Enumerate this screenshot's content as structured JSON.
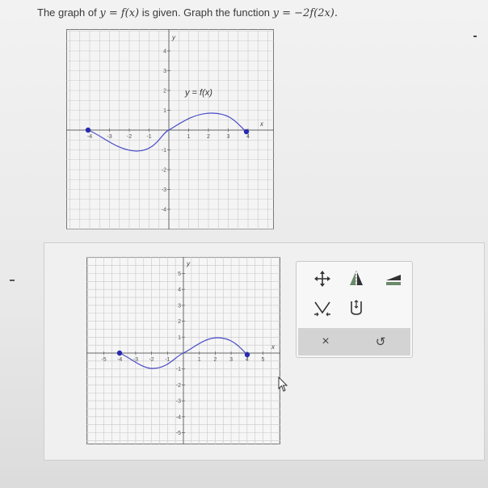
{
  "question": {
    "prefix": "The graph of",
    "given_eq": "y = f(x)",
    "middle": "is given. Graph the function",
    "target_eq": "y = −2f(2x)."
  },
  "given_graph": {
    "curve_label": "y = f(x)",
    "x_axis_label": "x",
    "y_axis_label": "y",
    "x_ticks": [
      "-4",
      "-3",
      "-2",
      "-1",
      "1",
      "2",
      "3",
      "4"
    ],
    "y_ticks": [
      "4",
      "3",
      "2",
      "1",
      "-1",
      "-2",
      "-3",
      "-4"
    ]
  },
  "answer_graph": {
    "x_axis_label": "x",
    "y_axis_label": "y",
    "x_ticks": [
      "-5",
      "-4",
      "-3",
      "-2",
      "-1",
      "1",
      "2",
      "3",
      "4",
      "5"
    ],
    "y_ticks": [
      "5",
      "4",
      "3",
      "2",
      "1",
      "-1",
      "-2",
      "-3",
      "-4",
      "-5"
    ]
  },
  "toolbar": {
    "tools": [
      "move-tool",
      "reflect-tool",
      "shrink-stretch-tool",
      "compress-tool",
      "expand-tool"
    ],
    "delete_label": "×",
    "undo_label": "↺"
  },
  "colors": {
    "curve": "#4a4ac8",
    "point": "#2a2ab0",
    "grid": "#c8c8c8",
    "axis": "#666666"
  }
}
